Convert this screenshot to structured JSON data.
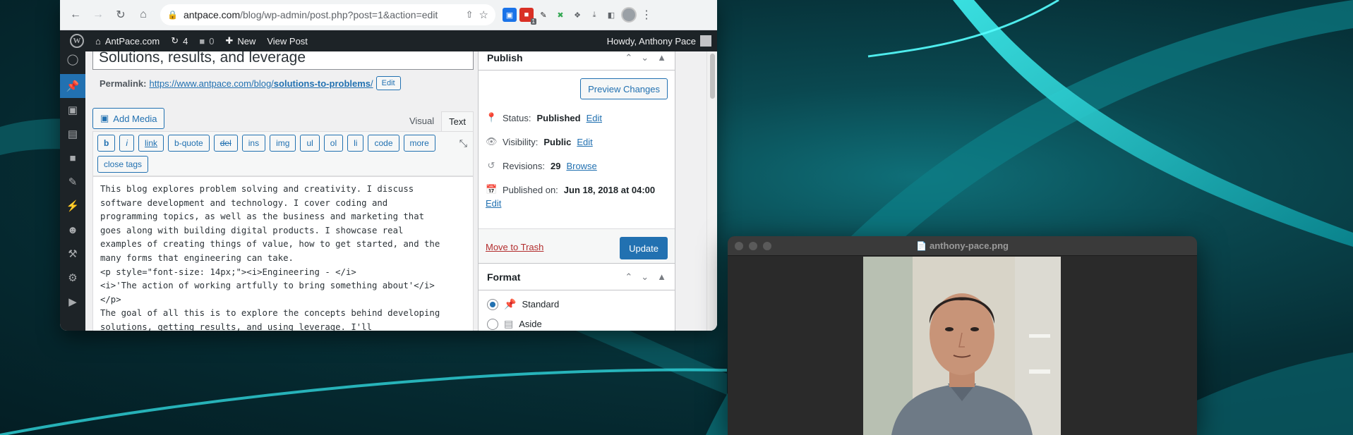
{
  "browser": {
    "url_host": "antpace.com",
    "url_path": "/blog/wp-admin/post.php?post=1&action=edit",
    "extension_badge": "1"
  },
  "adminbar": {
    "site_name": "AntPace.com",
    "updates_count": "4",
    "comments_count": "0",
    "new_label": "New",
    "view_post_label": "View Post",
    "greeting": "Howdy, Anthony Pace"
  },
  "editor": {
    "title": "Solutions, results, and leverage",
    "permalink_label": "Permalink:",
    "permalink_base": "https://www.antpace.com/blog/",
    "permalink_slug": "solutions-to-problems",
    "permalink_trailing": "/",
    "permalink_edit": "Edit",
    "add_media": "Add Media",
    "tab_visual": "Visual",
    "tab_text": "Text",
    "quicktags": [
      "b",
      "i",
      "link",
      "b-quote",
      "del",
      "ins",
      "img",
      "ul",
      "ol",
      "li",
      "code",
      "more",
      "close tags"
    ],
    "content": "This blog explores problem solving and creativity. I discuss\nsoftware development and technology. I cover coding and\nprogramming topics, as well as the business and marketing that\ngoes along with building digital products. I showcase real\nexamples of creating things of value, how to get started, and the\nmany forms that engineering can take.\n<p style=\"font-size: 14px;\"><i>Engineering - </i>\n<i>'The action of working artfully to bring something about'</i>\n</p>\nThe goal of all this is to explore the concepts behind developing\nsolutions, getting results, and using leverage. I'll"
  },
  "publish": {
    "title": "Publish",
    "preview_changes": "Preview Changes",
    "status_label": "Status:",
    "status_value": "Published",
    "visibility_label": "Visibility:",
    "visibility_value": "Public",
    "revisions_label": "Revisions:",
    "revisions_value": "29",
    "browse": "Browse",
    "published_on_label": "Published on:",
    "published_on_value": "Jun 18, 2018 at 04:00",
    "edit": "Edit",
    "move_to_trash": "Move to Trash",
    "update": "Update"
  },
  "format": {
    "title": "Format",
    "options": [
      {
        "label": "Standard",
        "checked": true
      },
      {
        "label": "Aside",
        "checked": false
      }
    ]
  },
  "preview_window": {
    "filename": "anthony-pace.png"
  },
  "colors": {
    "wp_blue": "#2271b1",
    "adminbar_bg": "#1d2327",
    "trash_red": "#b32d2e"
  }
}
